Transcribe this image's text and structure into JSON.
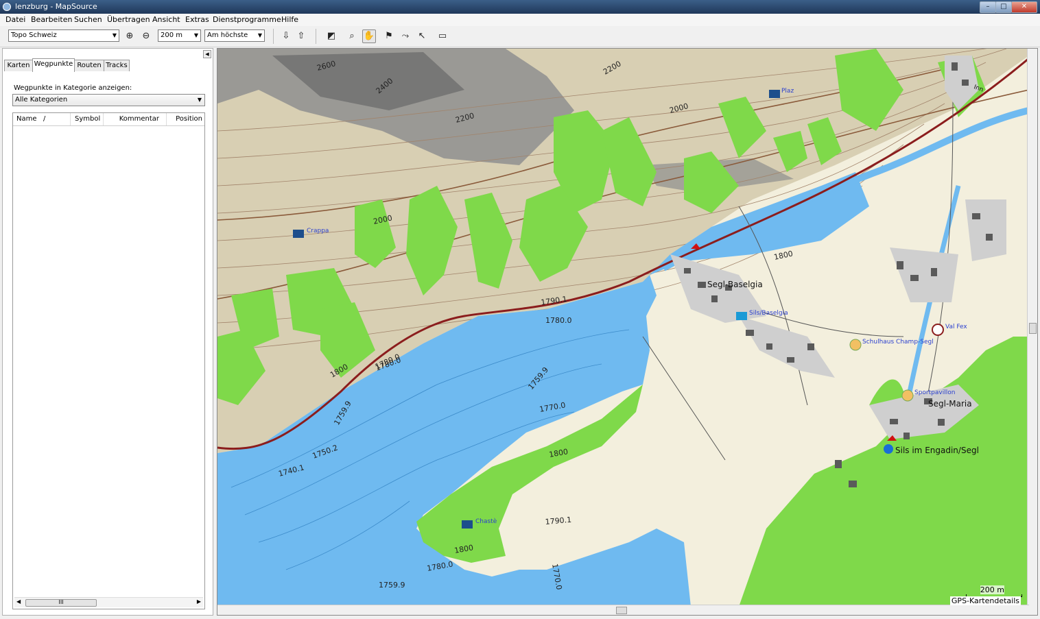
{
  "window": {
    "title": "lenzburg - MapSource",
    "min": "–",
    "max": "□",
    "close": "✕"
  },
  "menu": [
    "Datei",
    "Bearbeiten",
    "Suchen",
    "Übertragen",
    "Ansicht",
    "Extras",
    "Dienstprogramme",
    "Hilfe"
  ],
  "toolbar": {
    "map_product": "Topo Schweiz",
    "zoom_scale": "200 m",
    "detail_level": "Am höchste"
  },
  "panel": {
    "tabs": [
      "Karten",
      "Wegpunkte",
      "Routen",
      "Tracks"
    ],
    "active_tab": "Wegpunkte",
    "category_label": "Wegpunkte in Kategorie anzeigen:",
    "category_value": "Alle Kategorien",
    "columns": [
      "Name",
      "/",
      "Symbol",
      "Kommentar",
      "Position"
    ],
    "scroll_thumb": "III"
  },
  "map": {
    "colors": {
      "water": "#6fbaf0",
      "forest": "#7fd94a",
      "land": "#f3efdd",
      "contour": "#9a7a5a",
      "rock": "#8b8b8b",
      "road": "#8b1d1d"
    },
    "contour_labels": [
      "2600",
      "2400",
      "2200",
      "2200",
      "2000",
      "2000",
      "1800",
      "1780.0",
      "1800",
      "1790.1",
      "1780.0",
      "1780.0",
      "1759.9",
      "1770.0",
      "1759.9",
      "1750.2",
      "1740.1",
      "1790.1",
      "1800",
      "1780.0",
      "1759.9",
      "1770.0",
      "1800"
    ],
    "place_labels": [
      "Segl-Baselgia",
      "Segl-Maria",
      "Sils im Engadin/Segl",
      "Inn"
    ],
    "waypoints": [
      "Plaz",
      "Crappa",
      "Sils/Baselgia",
      "Val Fex",
      "Schulhaus Champ-Segl",
      "Sportpavillon",
      "Chastè"
    ],
    "scale_text": "200 m",
    "details_text": "GPS-Kartendetails"
  }
}
